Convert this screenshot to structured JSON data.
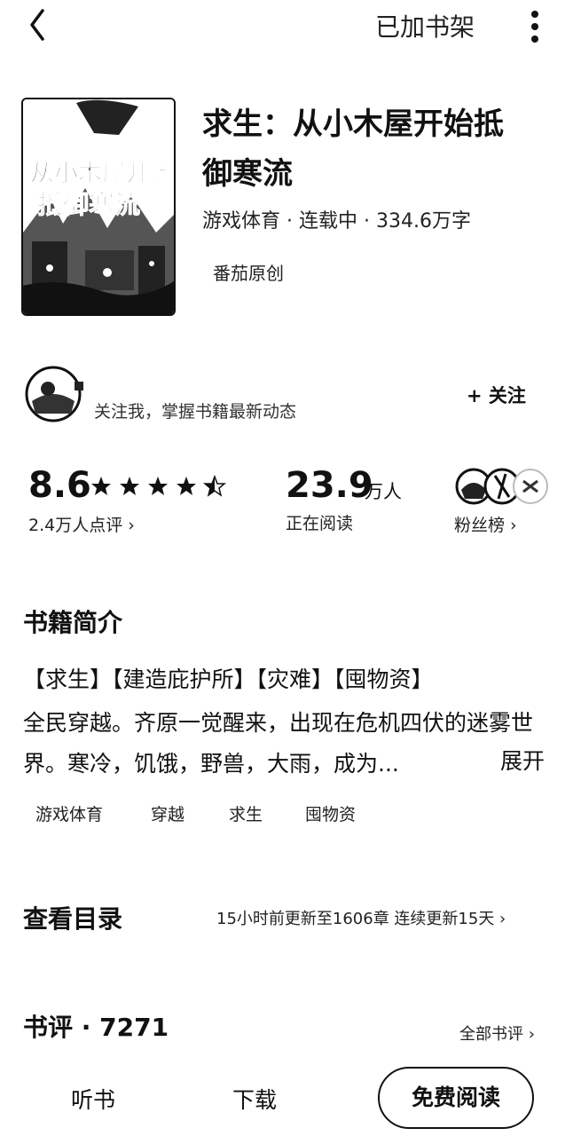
{
  "topbar": {
    "shelf_status": "已加书架"
  },
  "book": {
    "title_line1": "求生：从小木屋开始抵",
    "title_line2": "御寒流",
    "meta": "游戏体育 · 连载中 · 334.6万字",
    "publisher": "番茄原创",
    "cover_text": "求生：从小木屋开始抵御寒流"
  },
  "author": {
    "tip": "关注我，掌握书籍最新动态",
    "follow_label": "+ 关注"
  },
  "stats": {
    "rating": "8.6",
    "rating_stars": 4.5,
    "review_count": "2.4万人点评 ›",
    "readers": "23.9",
    "readers_unit": "万人",
    "readers_label": "正在阅读",
    "fans_label": "粉丝榜 ›"
  },
  "intro": {
    "title": "书籍简介",
    "tags_line": "【求生】【建造庇护所】【灾难】【囤物资】",
    "text": "全民穿越。齐原一觉醒来，出现在危机四伏的迷雾世界。寒冷，饥饿，野兽，大雨，成为...",
    "expand_label": "展开",
    "tags": [
      "游戏体育",
      "穿越",
      "求生",
      "囤物资"
    ]
  },
  "catalog": {
    "title": "查看目录",
    "update": "15小时前更新至1606章 连续更新15天 ›"
  },
  "reviews": {
    "title": "书评 · 7271",
    "all_label": "全部书评 ›"
  },
  "bottom": {
    "listen_label": "听书",
    "download_label": "下载",
    "read_label": "免费阅读"
  }
}
